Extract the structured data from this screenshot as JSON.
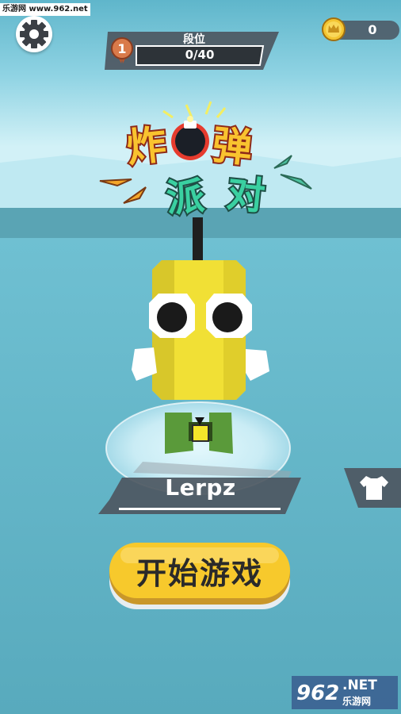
{
  "watermark_top": "乐游网 www.962.net",
  "rank": {
    "label": "段位",
    "progress_text": "0/40",
    "progress": 0,
    "medal_number": "1"
  },
  "coins": {
    "count": "0"
  },
  "title_logo": {
    "line1_a": "炸",
    "line1_b": "弹",
    "line2_a": "派",
    "line2_b": "对"
  },
  "player": {
    "name": "Lerpz"
  },
  "start_button": {
    "label": "开始游戏"
  },
  "icons": {
    "settings": "gear-icon",
    "coin": "crown-coin-icon",
    "skin": "tshirt-icon",
    "medal": "rank-medal-icon",
    "bomb": "bomb-icon"
  },
  "colors": {
    "sky": "#c9eef6",
    "sea": "#5fb3c6",
    "character": "#f2e13a",
    "start_button": "#f7c92c",
    "panel": "#4d5761"
  },
  "watermark_bottom": {
    "brand_digits": "962",
    "brand_suffix": ".NET",
    "brand_cn": "乐游网"
  }
}
